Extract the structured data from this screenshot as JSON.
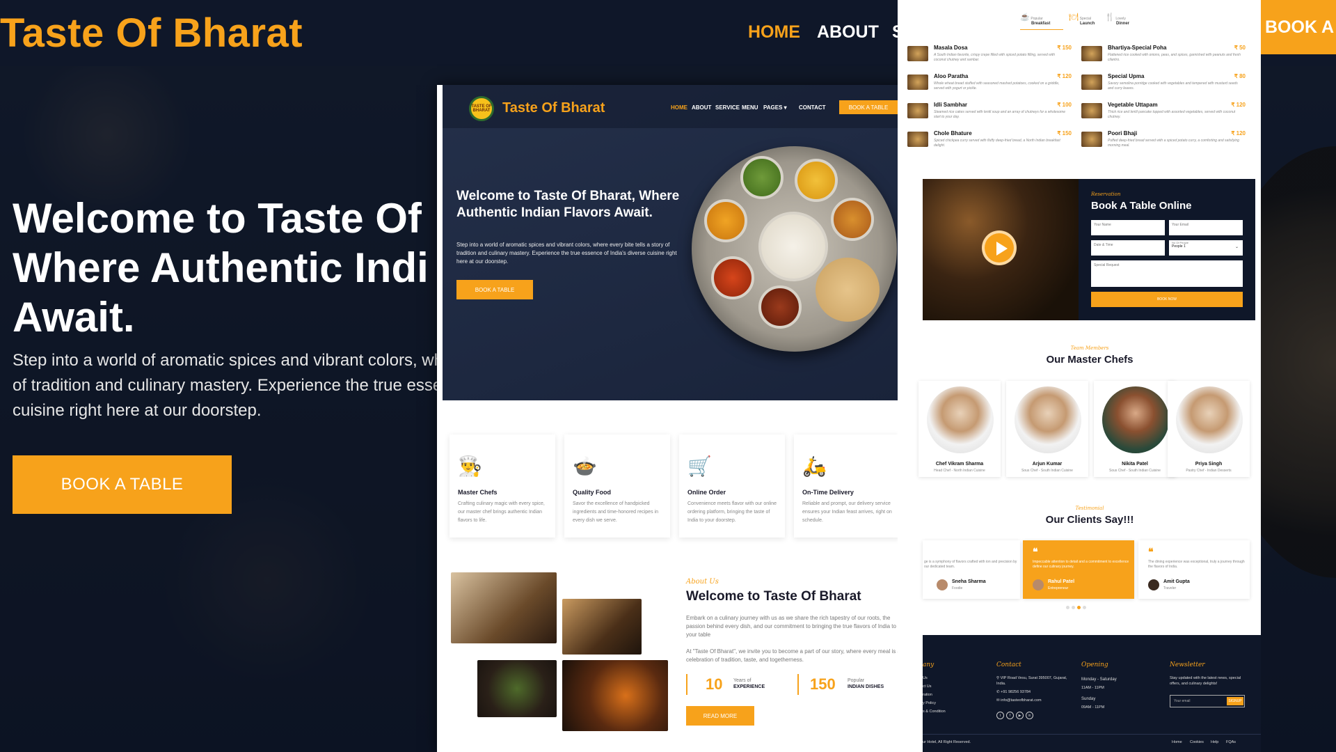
{
  "bg": {
    "logo": "Taste Of Bharat",
    "nav": [
      "HOME",
      "ABOUT"
    ],
    "nav_partial": "S",
    "headline": "Welcome to Taste Of\nWhere Authentic Indi\nAwait.",
    "para": "Step into a world of aromatic spices and vibrant colors, wh\nof tradition and culinary mastery. Experience the true esse\ncuisine right here at our doorstep.",
    "button": "BOOK A TABLE",
    "right_button": "BOOK A TA"
  },
  "colors": {
    "accent": "#f7a21b",
    "navy": "#0f1729"
  },
  "main": {
    "logo": "Taste Of Bharat",
    "logo_badge": "TASTE OF BHARAT",
    "nav": [
      "HOME",
      "ABOUT",
      "SERVICE",
      "MENU",
      "PAGES ▾",
      "CONTACT"
    ],
    "nav_button": "BOOK A TABLE",
    "hero_title": "Welcome to Taste Of Bharat, Where Authentic Indian Flavors Await.",
    "hero_text": "Step into a world of aromatic spices and vibrant colors, where every bite tells a story of tradition and culinary mastery. Experience the true essence of India's diverse cuisine right here at our doorstep.",
    "hero_button": "BOOK A TABLE",
    "features": [
      {
        "icon": "chef-icon",
        "glyph": "👨‍🍳",
        "title": "Master Chefs",
        "desc": "Crafting culinary magic with every spice, our master chef brings authentic Indian flavors to life."
      },
      {
        "icon": "food-icon",
        "glyph": "🍲",
        "title": "Quality Food",
        "desc": "Savor the excellence of handpicked ingredients and time-honored recipes in every dish we serve."
      },
      {
        "icon": "cart-icon",
        "glyph": "🛒",
        "title": "Online Order",
        "desc": "Convenience meets flavor with our online ordering platform, bringing the taste of India to your doorstep."
      },
      {
        "icon": "scooter-icon",
        "glyph": "🛵",
        "title": "On-Time Delivery",
        "desc": "Reliable and prompt, our delivery service ensures your Indian feast arrives, right on schedule."
      }
    ],
    "about_tag": "About Us",
    "about_title": "Welcome to Taste Of Bharat",
    "about_p1": "Embark on a culinary journey with us as we share the rich tapestry of our roots, the passion behind every dish, and our commitment to bringing the true flavors of India to your table",
    "about_p2": "At \"Taste Of Bharat\", we invite you to become a part of our story, where every meal is a celebration of tradition, taste, and togetherness.",
    "stats": [
      {
        "num": "10",
        "l1": "Years of",
        "l2": "EXPERIENCE"
      },
      {
        "num": "150",
        "l1": "Popular",
        "l2": "INDIAN DISHES"
      }
    ],
    "read_more": "READ MORE"
  },
  "right": {
    "menu_tabs": [
      {
        "icon": "breakfast-icon",
        "top": "Popular",
        "bottom": "Breakfast"
      },
      {
        "icon": "lunch-icon",
        "top": "Special",
        "bottom": "Launch"
      },
      {
        "icon": "dinner-icon",
        "top": "Lovely",
        "bottom": "Dinner"
      }
    ],
    "menu_items": [
      {
        "name": "Masala Dosa",
        "price": "₹ 150",
        "desc": "A South Indian favorite, crispy crepe filled with spiced potato filling, served with coconut chutney and sambar."
      },
      {
        "name": "Bhartiya-Special Poha",
        "price": "₹ 50",
        "desc": "Flattened rice cooked with onions, peas, and spices, garnished with peanuts and fresh cilantro."
      },
      {
        "name": "Aloo Paratha",
        "price": "₹ 120",
        "desc": "Whole wheat bread stuffed with seasoned mashed potatoes, cooked on a griddle, served with yogurt or pickle."
      },
      {
        "name": "Special Upma",
        "price": "₹ 80",
        "desc": "Savory semolina porridge cooked with vegetables and tempered with mustard seeds and curry leaves."
      },
      {
        "name": "Idli Sambhar",
        "price": "₹ 100",
        "desc": "Steamed rice cakes served with lentil soup and an array of chutneys for a wholesome start to your day."
      },
      {
        "name": "Vegetable Uttapam",
        "price": "₹ 120",
        "desc": "Thick rice and lentil pancake topped with assorted vegetables, served with coconut chutney."
      },
      {
        "name": "Chole Bhature",
        "price": "₹ 150",
        "desc": "Spiced chickpea curry served with fluffy deep-fried bread, a North Indian breakfast delight."
      },
      {
        "name": "Poori Bhaji",
        "price": "₹ 120",
        "desc": "Puffed deep-fried bread served with a spiced potato curry, a comforting and satisfying morning meal."
      }
    ],
    "resv_tag": "Reservation",
    "resv_title": "Book A Table Online",
    "fields": {
      "name": "Your Name",
      "email": "Your Email",
      "date": "Date & Time",
      "people_label": "No Of People",
      "people": "People 1",
      "request": "Special Request"
    },
    "book_now": "BOOK NOW",
    "team_tag": "Team Members",
    "team_title": "Our Master Chefs",
    "chefs": [
      {
        "name": "Chef Vikram Sharma",
        "role": "Head Chef - North Indian Cuisine"
      },
      {
        "name": "Arjun Kumar",
        "role": "Sous Chef - South Indian Cuisine"
      },
      {
        "name": "Nikita Patel",
        "role": "Sous Chef - South Indian Cuisine"
      },
      {
        "name": "Priya Singh",
        "role": "Pastry Chef - Indian Desserts"
      }
    ],
    "testi_tag": "Testimonial",
    "testi_title": "Our Clients Say!!!",
    "testimonials": [
      {
        "desc": "ge is a symphony of flavors crafted with ion and precision by our dedicated team.",
        "name": "Sneha Sharma",
        "role": "Foodie"
      },
      {
        "desc": "Impeccable attention to detail and a commitment to excellence define our culinary journey.",
        "name": "Rahul Patel",
        "role": "Entrepreneur"
      },
      {
        "desc": "The dining experience was exceptional, truly a journey through the flavors of India.",
        "name": "Amit Gupta",
        "role": "Traveler"
      }
    ],
    "footer": {
      "company_head": "any",
      "company_links": [
        "Us",
        "ct Us",
        "ration",
        "y Policy",
        "s & Condition"
      ],
      "contact_head": "Contact",
      "address": "VIP Road Vesu, Surat 395007, Gujarat, India.",
      "phone": "+91 98256 93784",
      "email": "info@tasteofbharat.com",
      "opening_head": "Opening",
      "days1": "Monday - Saturday",
      "hours1": "11AM - 11PM",
      "days2": "Sunday",
      "hours2": "09AM - 11PM",
      "news_head": "Newsletter",
      "news_text": "Stay updated with the latest news, special offers, and culinary delights!",
      "news_placeholder": "Your email",
      "news_button": "SIGNUP",
      "copyright": "ur Hotel, All Right Reserved.",
      "bottom_links": [
        "Home",
        "Cookies",
        "Help",
        "FQAs"
      ]
    }
  }
}
